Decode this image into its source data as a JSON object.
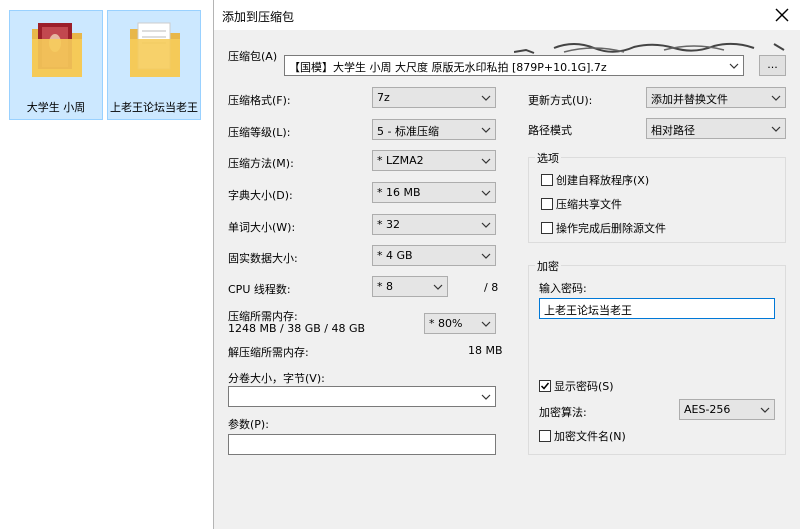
{
  "desktop": {
    "folders": [
      {
        "label": "大学生 小周"
      },
      {
        "label": "上老王论坛当老王"
      }
    ]
  },
  "dialog": {
    "title": "添加到压缩包",
    "archive": {
      "label": "压缩包(A)",
      "value": "【国模】大学生 小周 大尺度 原版无水印私拍 [879P+10.1G].7z",
      "browse_label": "..."
    },
    "left": {
      "format": {
        "label": "压缩格式(F):",
        "value": "7z"
      },
      "level": {
        "label": "压缩等级(L):",
        "value": "5 - 标准压缩"
      },
      "method": {
        "label": "压缩方法(M):",
        "value": "* LZMA2"
      },
      "dict": {
        "label": "字典大小(D):",
        "value": "* 16 MB"
      },
      "word": {
        "label": "单词大小(W):",
        "value": "* 32"
      },
      "solid": {
        "label": "固实数据大小:",
        "value": "* 4 GB"
      },
      "cpu": {
        "label": "CPU 线程数:",
        "value": "* 8",
        "max": "/ 8"
      },
      "memory": {
        "label": "压缩所需内存:",
        "detail": "1248 MB / 38 GB / 48 GB",
        "value": "* 80%"
      },
      "decompress": {
        "label": "解压缩所需内存:",
        "value": "18 MB"
      },
      "volume": {
        "label": "分卷大小，字节(V):",
        "value": ""
      },
      "params": {
        "label": "参数(P):",
        "value": ""
      }
    },
    "right": {
      "update": {
        "label": "更新方式(U):",
        "value": "添加并替换文件"
      },
      "pathmode": {
        "label": "路径模式",
        "value": "相对路径"
      },
      "options": {
        "title": "选项",
        "sfx": "创建自释放程序(X)",
        "shared": "压缩共享文件",
        "delete": "操作完成后删除源文件"
      },
      "encryption": {
        "title": "加密",
        "password_label": "输入密码:",
        "password_value": "上老王论坛当老王",
        "show_password": "显示密码(S)",
        "method_label": "加密算法:",
        "method_value": "AES-256",
        "encrypt_names": "加密文件名(N)"
      }
    }
  }
}
